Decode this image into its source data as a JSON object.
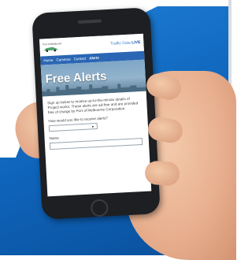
{
  "site": {
    "logo_text": "Port of Melbourne",
    "header_link": "Traffic Data ",
    "header_link_strong": "LIVE"
  },
  "nav": [
    "Home",
    "Cameras",
    "Contact",
    "Alerts"
  ],
  "hero": {
    "title": "Free Alerts"
  },
  "content": {
    "intro": "Sign up below to receive up-to-the-minute details of Project works. These alerts are ad-free and are provided free of charge by Port of Melbourne Corporation.",
    "question": "How would you like to receive alerts?",
    "name_label": "Name"
  },
  "colors": {
    "background_blue": "#0e63b9",
    "nav_blue": "#2a66b4",
    "phone_body": "#1d1f22"
  }
}
